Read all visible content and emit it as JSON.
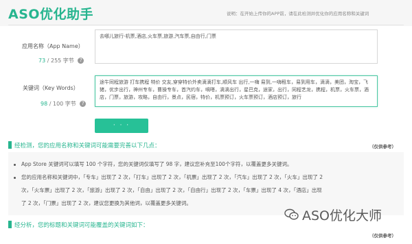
{
  "header": {
    "title": "ASO优化助手",
    "hint": "说明：在开始上传你的APP前，请在此检测并优化你的应用名称和关键词"
  },
  "app_name": {
    "label": "应用名称（App Name）",
    "value": "去哪儿旅行-机票,酒店,火车票,旅游,汽车票,自由行,门票",
    "count": "73",
    "limit": "/ 255 字节",
    "help": "?"
  },
  "keywords": {
    "label": "关键词（Key Words）",
    "value": "途牛同程旅游 打车携程 特价 交友,穿穿特价外卖滴滴打车,顺风车 出行,一嗨 易到,一嗨租车，易到用车，滴滴，美团，淘宝，飞猪，优步出行，神州专车，曹操专车，首汽约车，嘀嗒，滴滴出行，星巴克，途家，出行，同程艺龙，携程，机票，火车票，酒店，门票，旅游，攻略，自由行，景点，民宿，特价，机票预订，火车票预订，酒店预订，旅行",
    "count": "98",
    "limit": "/ 100 字节",
    "help": "?"
  },
  "submit": {
    "label": "· · ·"
  },
  "check_section": {
    "title": "经检测，您的应用名称和关键词可能需要完善以下几点：",
    "ref": "（仅供参考）"
  },
  "results": {
    "line1": "App Store 关键词可以填写 100 个字符，您的关键词仅填写了 98 字，建议您补充至100个字符，以覆盖更多关键词。",
    "line2": "您的应用名称和关键词中，「专车」出现了 2 次，「打车」出现了 2 次，「机票」出现了 2 次，「汽车」出现了 2 次，「火车」出现了 2",
    "line3": "次，「火车票」出现了 2 次，「旅游」出现了 2 次，「自由」出现了 2 次，「自由行」出现了 2 次，「车票」出现了 4 次，「酒店」出现",
    "line4": "了 2 次，「门票」出现了 2 次，建议您更换为其他词，以覆盖更多关键词。"
  },
  "analysis_section": {
    "title": "经分析，您的标题和关键词可能覆盖的关键词如下：",
    "ref": "（仅供参考）"
  },
  "watermark": {
    "text": "ASO优化大师"
  },
  "colors": {
    "accent": "#27b58f",
    "button": "#27c197"
  }
}
